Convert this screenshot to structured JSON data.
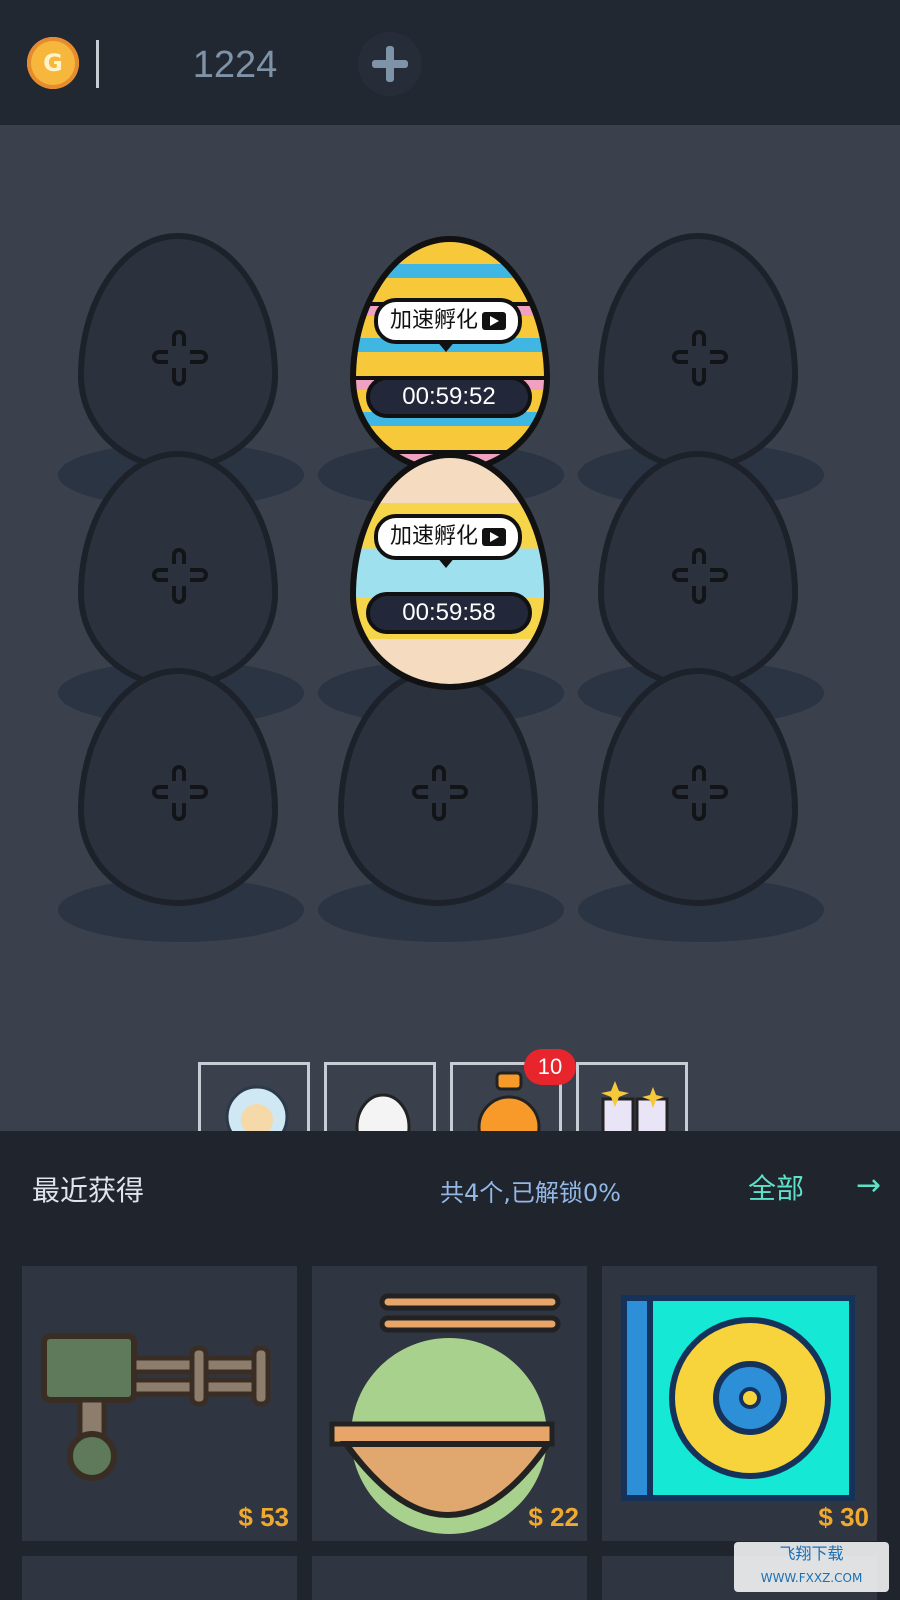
{
  "header": {
    "coin_icon_letter": "G",
    "coins": "1224"
  },
  "incubators": [
    {
      "speed_label": "加速孵化",
      "timer": "00:59:52"
    },
    {
      "speed_label": "加速孵化",
      "timer": "00:59:58"
    }
  ],
  "shortcuts": {
    "badge_count": "10"
  },
  "recent": {
    "title": "最近获得",
    "unlocked": "共4个,已解锁0%",
    "all_label": "全部",
    "arrow": "→"
  },
  "items": [
    {
      "name": "gatling-gun",
      "price": "$ 53"
    },
    {
      "name": "noodles",
      "price": "$ 22"
    },
    {
      "name": "vinyl-record",
      "price": "$ 30"
    }
  ],
  "watermark": {
    "line1": "飞翔下载",
    "line2": "WWW.FXXZ.COM"
  },
  "colors": {
    "accent": "#5fe0c8",
    "price": "#f0a930",
    "badge": "#e8242c"
  }
}
